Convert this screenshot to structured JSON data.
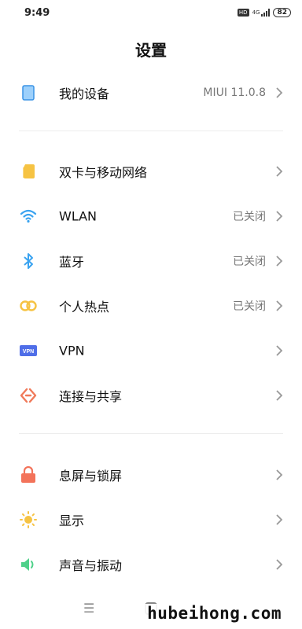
{
  "status_bar": {
    "time": "9:49",
    "hd": "HD",
    "network": "4G",
    "battery": "82"
  },
  "title": "设置",
  "groups": [
    {
      "items": [
        {
          "name": "my-device",
          "label": "我的设备",
          "value": "MIUI 11.0.8",
          "icon": "device-icon",
          "color": "#5aaef5"
        }
      ]
    },
    {
      "items": [
        {
          "name": "dual-sim",
          "label": "双卡与移动网络",
          "value": "",
          "icon": "sim-card-icon",
          "color": "#f6c343"
        },
        {
          "name": "wlan",
          "label": "WLAN",
          "value": "已关闭",
          "icon": "wifi-icon",
          "color": "#3aa3f0"
        },
        {
          "name": "bluetooth",
          "label": "蓝牙",
          "value": "已关闭",
          "icon": "bluetooth-icon",
          "color": "#3aa3f0"
        },
        {
          "name": "hotspot",
          "label": "个人热点",
          "value": "已关闭",
          "icon": "hotspot-icon",
          "color": "#f6c343"
        },
        {
          "name": "vpn",
          "label": "VPN",
          "value": "",
          "icon": "vpn-icon",
          "color": "#4f6ee8"
        },
        {
          "name": "connection-sharing",
          "label": "连接与共享",
          "value": "",
          "icon": "share-icon",
          "color": "#f07a5a"
        }
      ]
    },
    {
      "items": [
        {
          "name": "lock-screen",
          "label": "息屏与锁屏",
          "value": "",
          "icon": "lock-icon",
          "color": "#f3735a"
        },
        {
          "name": "display",
          "label": "显示",
          "value": "",
          "icon": "sun-icon",
          "color": "#f6c343"
        },
        {
          "name": "sound",
          "label": "声音与振动",
          "value": "",
          "icon": "speaker-icon",
          "color": "#4fd18a"
        }
      ]
    }
  ],
  "nav": {
    "menu_glyph": "☰"
  },
  "watermark": "hubeihong.com"
}
